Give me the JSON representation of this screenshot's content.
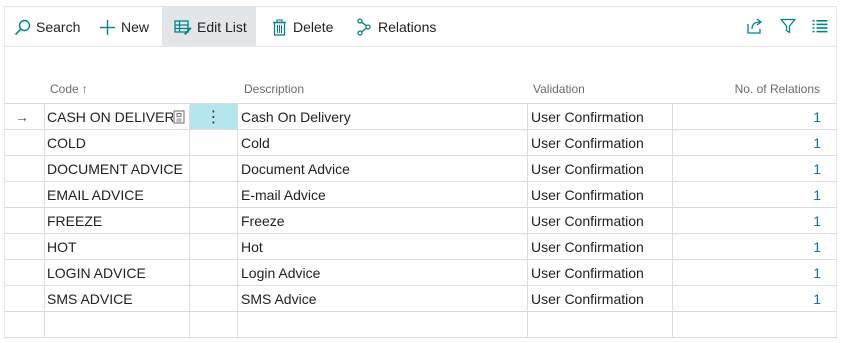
{
  "toolbar": {
    "search_label": "Search",
    "new_label": "New",
    "edit_list_label": "Edit List",
    "delete_label": "Delete",
    "relations_label": "Relations",
    "icons": [
      "search-icon",
      "plus-icon",
      "edit-list-icon",
      "trash-icon",
      "relations-icon",
      "share-icon",
      "filter-icon",
      "list-view-icon"
    ],
    "accent_color": "#008489"
  },
  "columns": {
    "code": "Code",
    "code_sort": "↑",
    "description": "Description",
    "validation": "Validation",
    "relations": "No. of Relations"
  },
  "rows": [
    {
      "code": "CASH ON DELIVERY",
      "description": "Cash On Delivery",
      "validation": "User Confirmation",
      "relations": "1"
    },
    {
      "code": "COLD",
      "description": "Cold",
      "validation": "User Confirmation",
      "relations": "1"
    },
    {
      "code": "DOCUMENT ADVICE",
      "description": "Document Advice",
      "validation": "User Confirmation",
      "relations": "1"
    },
    {
      "code": "EMAIL ADVICE",
      "description": "E-mail Advice",
      "validation": "User Confirmation",
      "relations": "1"
    },
    {
      "code": "FREEZE",
      "description": "Freeze",
      "validation": "User Confirmation",
      "relations": "1"
    },
    {
      "code": "HOT",
      "description": "Hot",
      "validation": "User Confirmation",
      "relations": "1"
    },
    {
      "code": "LOGIN ADVICE",
      "description": "Login Advice",
      "validation": "User Confirmation",
      "relations": "1"
    },
    {
      "code": "SMS ADVICE",
      "description": "SMS Advice",
      "validation": "User Confirmation",
      "relations": "1"
    }
  ],
  "selected_row_marker": "→",
  "row_menu_glyph": "⋮",
  "link_color": "#0b74a8"
}
